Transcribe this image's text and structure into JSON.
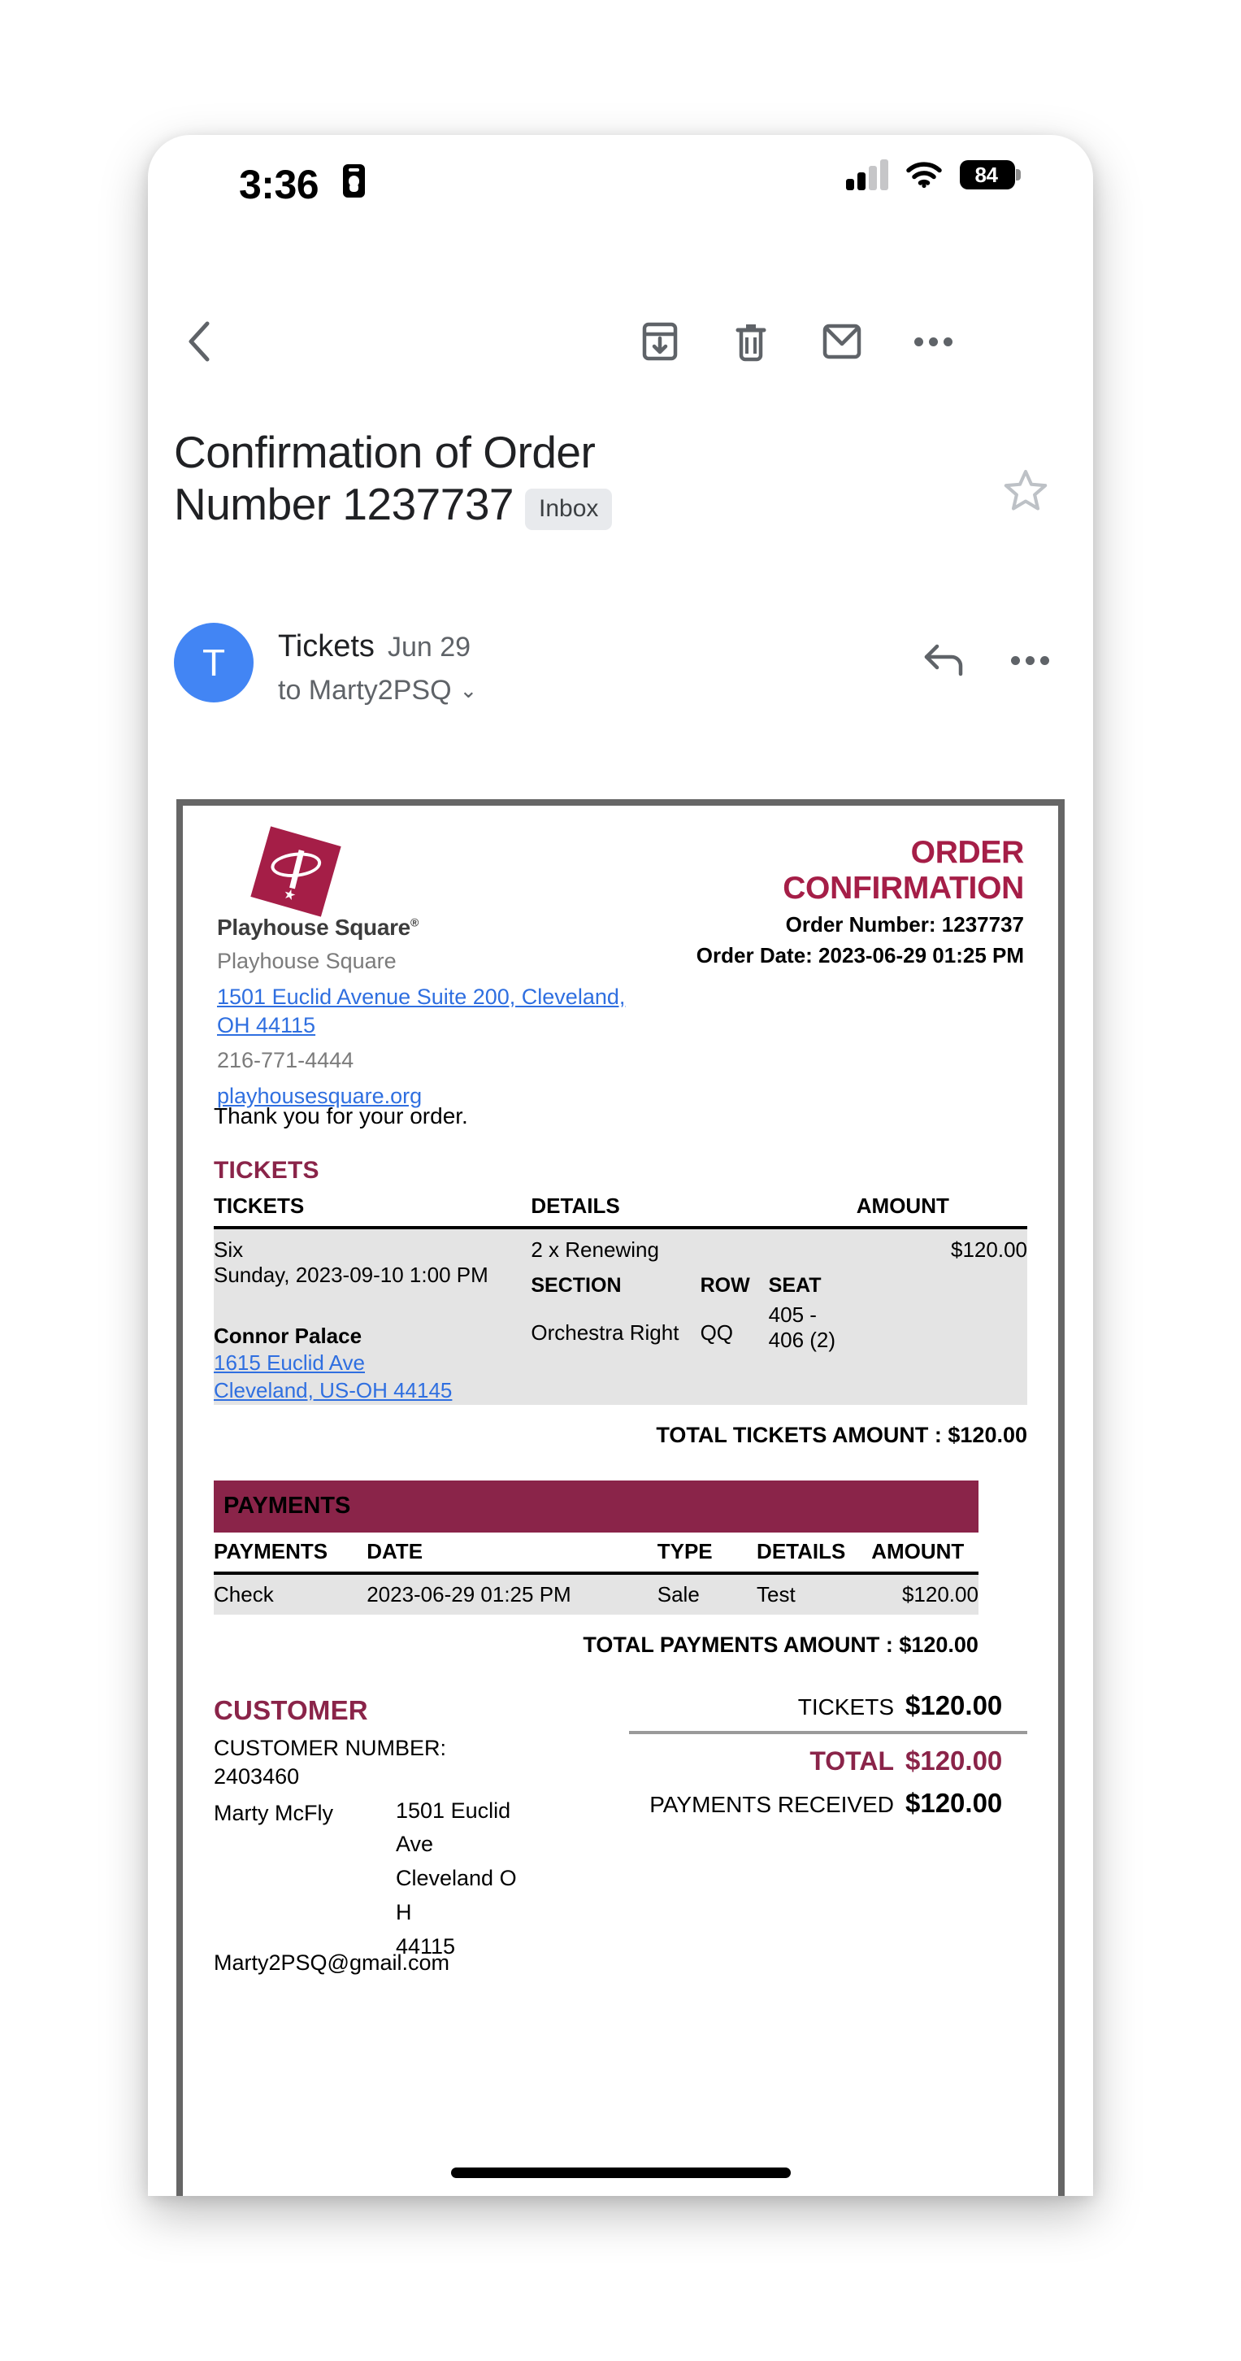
{
  "status_bar": {
    "time": "3:36",
    "badge_icon": "id-badge-icon",
    "signal_icon": "cellular-signal-icon",
    "wifi_icon": "wifi-icon",
    "battery_level": "84"
  },
  "toolbar": {
    "back": "back-chevron-icon",
    "archive": "archive-icon",
    "delete": "trash-icon",
    "mark_unread": "mail-icon",
    "more": "more-options-icon"
  },
  "subject": {
    "line1": "Confirmation of Order",
    "line2": "Number 1237737",
    "label_chip": "Inbox",
    "star": "star-icon"
  },
  "sender": {
    "avatar_letter": "T",
    "name": "Tickets",
    "date": "Jun 29",
    "recipient": "to Marty2PSQ",
    "chevron": "⌄",
    "reply_icon": "reply-arrow-icon",
    "more_icon": "more-options-icon"
  },
  "receipt": {
    "brand": {
      "wordmark": "Playhouse Square",
      "registered": "®",
      "name": "Playhouse Square",
      "address": "1501 Euclid Avenue Suite 200, Cleveland, OH 44115",
      "phone": "216-771-4444",
      "website": "playhousesquare.org"
    },
    "confirmation": {
      "title_line1": "ORDER",
      "title_line2": "CONFIRMATION",
      "order_number": "Order Number: 1237737",
      "order_date": "Order Date: 2023-06-29 01:25 PM"
    },
    "thanks": "Thank you for your order.",
    "tickets_section": {
      "heading": "TICKETS",
      "columns": [
        "TICKETS",
        "DETAILS",
        "AMOUNT"
      ],
      "row": {
        "show": "Six",
        "datetime": "Sunday, 2023-09-10 1:00 PM",
        "venue": "Connor Palace",
        "venue_address_line1": "1615 Euclid Ave",
        "venue_address_line2": "Cleveland, US-OH 44145",
        "quantity_type": "2 x Renewing",
        "sub_columns": [
          "SECTION",
          "ROW",
          "SEAT"
        ],
        "section": "Orchestra Right",
        "seat_row": "QQ",
        "seat_line1": "405 -",
        "seat_line2": "406 (2)",
        "amount": "$120.00"
      },
      "total": "TOTAL TICKETS AMOUNT : $120.00"
    },
    "payments_section": {
      "banner": "PAYMENTS",
      "columns": [
        "PAYMENTS",
        "DATE",
        "TYPE",
        "DETAILS",
        "AMOUNT"
      ],
      "row": {
        "method": "Check",
        "date": "2023-06-29 01:25 PM",
        "type": "Sale",
        "details": "Test",
        "amount": "$120.00"
      },
      "total": "TOTAL PAYMENTS AMOUNT : $120.00"
    },
    "customer_section": {
      "heading": "CUSTOMER",
      "number_label": "CUSTOMER NUMBER:",
      "number": "2403460",
      "name": "Marty McFly",
      "address_line1": "1501 Euclid",
      "address_line2": "Ave",
      "address_line3": "Cleveland O",
      "address_line4": "H",
      "address_line5": "44115",
      "email": "Marty2PSQ@gmail.com"
    },
    "totals": {
      "tickets_label": "TICKETS",
      "tickets_value": "$120.00",
      "total_label": "TOTAL",
      "total_value": "$120.00",
      "payments_label": "PAYMENTS RECEIVED",
      "payments_value": "$120.00"
    }
  },
  "colors": {
    "brand_crimson": "#a51e47",
    "banner_crimson": "#8a2449",
    "link_blue": "#2f6fe0",
    "avatar_blue": "#4285f4"
  }
}
